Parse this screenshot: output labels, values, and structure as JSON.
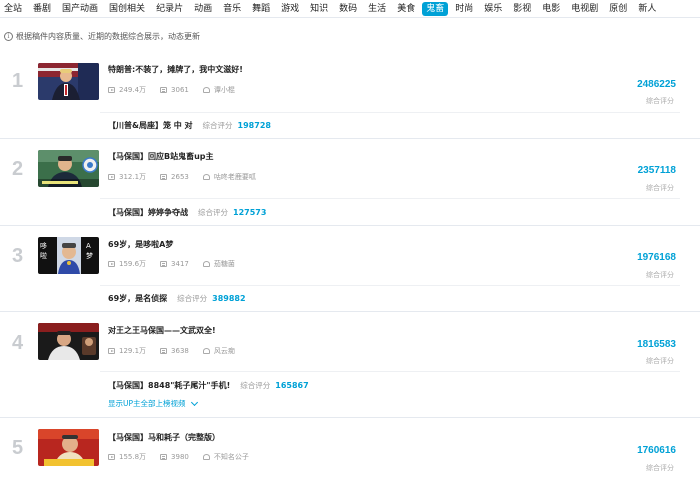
{
  "tabs": [
    "全站",
    "番剧",
    "国产动画",
    "国创相关",
    "纪录片",
    "动画",
    "音乐",
    "舞蹈",
    "游戏",
    "知识",
    "数码",
    "生活",
    "美食",
    "鬼畜",
    "时尚",
    "娱乐",
    "影视",
    "电影",
    "电视剧",
    "原创",
    "新人"
  ],
  "active_tab": "鬼畜",
  "notice": "根据稿件内容质量、近期的数据综合展示，动态更新",
  "score_label": "综合评分",
  "more_link": "显示UP主全部上榜视频",
  "items": [
    {
      "rank": "1",
      "title": "特朗普:不装了，摊牌了，我中文滋好!",
      "plays": "249.4万",
      "danmaku": "3061",
      "author": "谭小棍",
      "score": "2486225",
      "sub_title": "【川普&局座】笼 中 对",
      "sub_score": "198728"
    },
    {
      "rank": "2",
      "title": "【马保国】回应B站鬼畜up主",
      "plays": "312.1万",
      "danmaku": "2653",
      "author": "咕咚老鹿要呱",
      "score": "2357118",
      "sub_title": "【马保国】婷婷争夺战",
      "sub_score": "127573"
    },
    {
      "rank": "3",
      "title": "69岁，是哆啦A梦",
      "plays": "159.6万",
      "danmaku": "3417",
      "author": "茄糖菌",
      "score": "1976168",
      "sub_title": "69岁，是名侦探",
      "sub_score": "389882",
      "thumb_left": "哆\n啦",
      "thumb_right": "A\n梦"
    },
    {
      "rank": "4",
      "title": "对王之王马保国——文武双全!",
      "plays": "129.1万",
      "danmaku": "3638",
      "author": "风云痴",
      "score": "1816583",
      "sub_title": "【马保国】8848\"耗子尾汁\"手机!",
      "sub_score": "165867"
    },
    {
      "rank": "5",
      "title": "【马保国】马和耗子（完整版）",
      "plays": "155.8万",
      "danmaku": "3980",
      "author": "不知名公子",
      "score": "1760616"
    }
  ]
}
